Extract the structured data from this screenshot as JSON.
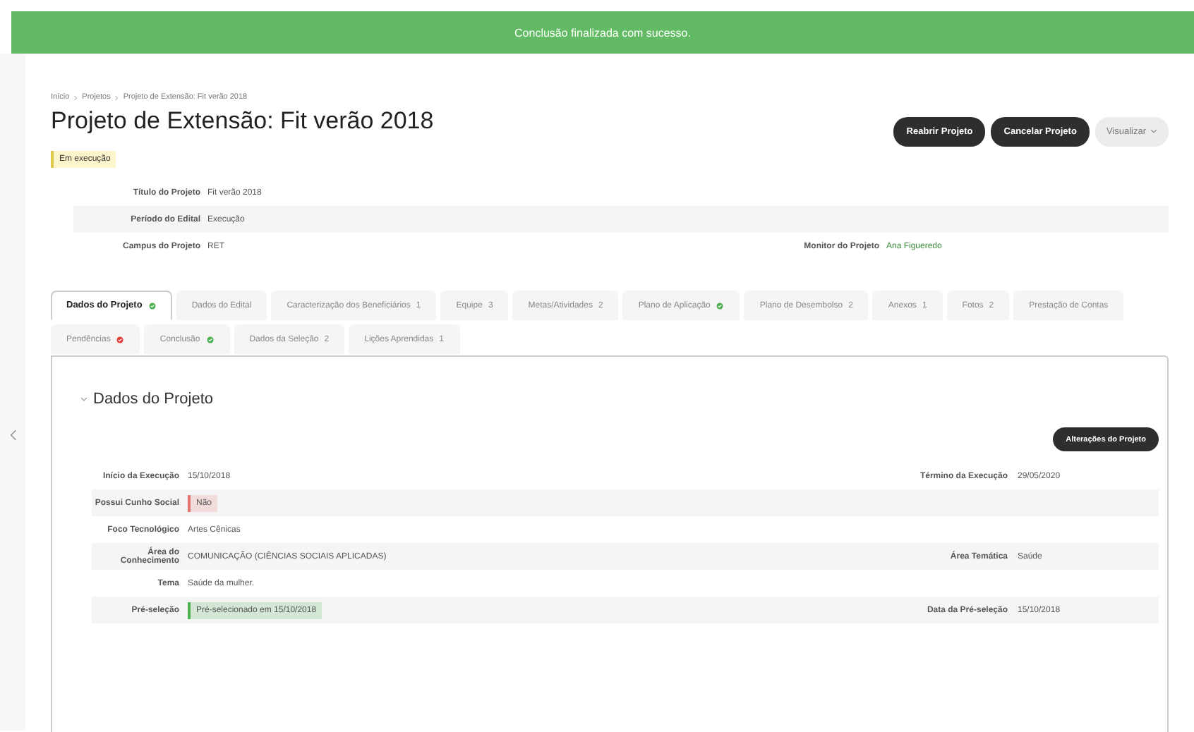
{
  "banner": "Conclusão finalizada com sucesso.",
  "breadcrumb": [
    "Início",
    "Projetos",
    "Projeto de Extensão: Fit verão 2018"
  ],
  "title": "Projeto de Extensão: Fit verão 2018",
  "status": "Em execução",
  "actions": [
    {
      "label": "Reabrir Projeto",
      "kind": "dark"
    },
    {
      "label": "Cancelar Projeto",
      "kind": "dark"
    },
    {
      "label": "Visualizar",
      "kind": "dropdown"
    }
  ],
  "summary": [
    {
      "label": "Título do Projeto",
      "value": "Fit verão 2018"
    },
    {
      "label": "Período do Edital",
      "value": "Execução"
    },
    {
      "label": "Campus do Projeto",
      "value": "RET",
      "right": {
        "label": "Monitor do Projeto",
        "value": "Ana Figueredo",
        "kind": "link"
      }
    }
  ],
  "tabs": [
    {
      "label": "Dados do Projeto",
      "selected": true,
      "kind": "dot",
      "color": "#4caf50"
    },
    {
      "label": "Dados do Edital",
      "selected": false,
      "kind": "none"
    },
    {
      "label": "Caracterização dos Beneficiários",
      "selected": false,
      "kind": "count",
      "count": "1"
    },
    {
      "label": "Equipe",
      "selected": false,
      "kind": "count",
      "count": "3"
    },
    {
      "label": "Metas/Atividades",
      "selected": false,
      "kind": "count",
      "count": "2"
    },
    {
      "label": "Plano de Aplicação",
      "selected": false,
      "kind": "dot",
      "color": "#4caf50"
    },
    {
      "label": "Plano de Desembolso",
      "selected": false,
      "kind": "count",
      "count": "2"
    },
    {
      "label": "Anexos",
      "selected": false,
      "kind": "count",
      "count": "1"
    },
    {
      "label": "Fotos",
      "selected": false,
      "kind": "count",
      "count": "2"
    },
    {
      "label": "Prestação de Contas",
      "selected": false,
      "kind": "none"
    },
    {
      "label": "Pendências",
      "selected": false,
      "kind": "dot",
      "color": "#e53935"
    },
    {
      "label": "Conclusão",
      "selected": false,
      "kind": "dot",
      "color": "#4caf50"
    },
    {
      "label": "Dados da Seleção",
      "selected": false,
      "kind": "count",
      "count": "2"
    },
    {
      "label": "Lições Aprendidas",
      "selected": false,
      "kind": "count",
      "count": "1"
    }
  ],
  "section": {
    "title": "Dados do Projeto",
    "expanded": true,
    "button": "Alterações do Projeto",
    "rows": [
      {
        "label": "Início da Execução",
        "value": "15/10/2018",
        "kind": "text",
        "right_label": "Término da Execução",
        "right_value": "29/05/2020"
      },
      {
        "label": "Possui Cunho Social",
        "value": "Não",
        "kind": "tag",
        "color": "#e57373"
      },
      {
        "label": "Foco Tecnológico",
        "value": "Artes Cênicas",
        "kind": "text"
      },
      {
        "label": "Área do Conhecimento",
        "value": "COMUNICAÇÃO (CIÊNCIAS SOCIAIS APLICADAS)",
        "kind": "text",
        "right_label": "Área Temática",
        "right_value": "Saúde"
      },
      {
        "label": "Tema",
        "value": "Saúde da mulher.",
        "kind": "text"
      },
      {
        "label": "Pré-seleção",
        "value": "Pré-selecionado em 15/10/2018",
        "kind": "tag",
        "color": "#4caf50",
        "right_label": "Data da Pré-seleção",
        "right_value": "15/10/2018"
      }
    ]
  }
}
